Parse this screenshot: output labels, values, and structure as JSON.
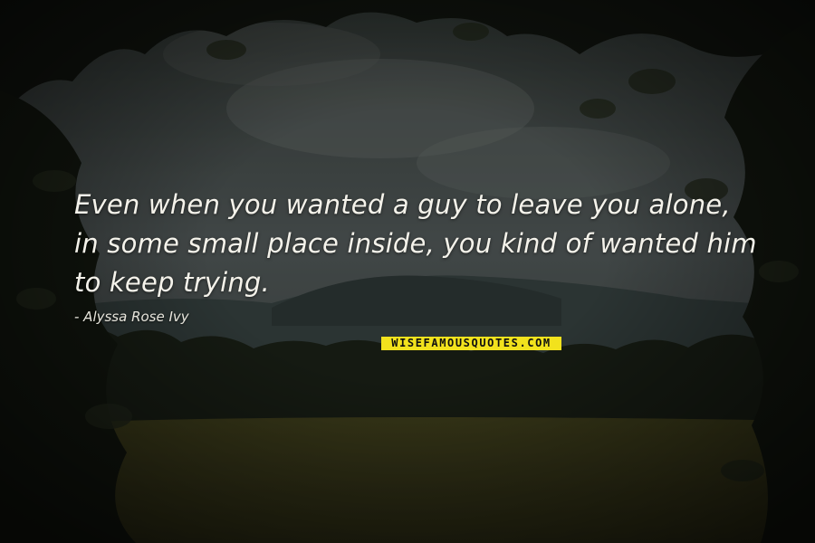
{
  "quote": {
    "lines": [
      "Even when you wanted a guy to leave you alone,",
      "in some small place inside, you kind of wanted him",
      "to keep trying."
    ],
    "author": "- Alyssa Rose Ivy"
  },
  "brand": {
    "logo_text": "WISEFAMOUSQUOTES.COM",
    "logo_color": "#f2e21d"
  },
  "background": {
    "description_icon": "forest-landscape-image",
    "sky_color": "#4c5555",
    "foliage_color": "#1e2418",
    "field_color": "#5e5a26"
  }
}
